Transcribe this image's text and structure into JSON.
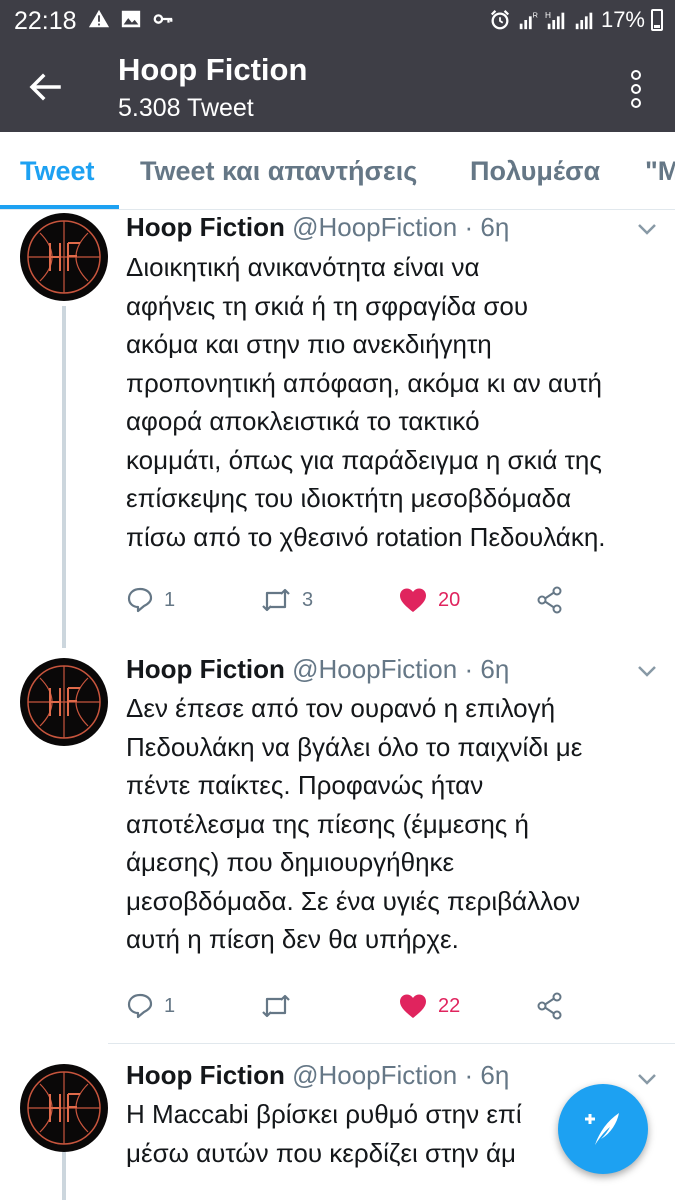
{
  "status_bar": {
    "time": "22:18",
    "battery": "17%",
    "left_icons": [
      "warning-icon",
      "image-icon",
      "key-icon"
    ],
    "right_icons": [
      "alarm-icon",
      "signal-r-icon",
      "signal-h-icon",
      "signal-icon"
    ]
  },
  "header": {
    "title": "Hoop Fiction",
    "subtitle": "5.308 Tweet"
  },
  "tabs": [
    {
      "label": "Tweet",
      "active": true
    },
    {
      "label": "Tweet και απαντήσεις",
      "active": false
    },
    {
      "label": "Πολυμέσα",
      "active": false
    },
    {
      "label": "\"Μ",
      "active": false
    }
  ],
  "tweets": [
    {
      "name": "Hoop Fiction",
      "handle": "@HoopFiction",
      "dot": "·",
      "time": "6η",
      "lines": [
        "Διοικητική ανικανότητα είναι να",
        "αφήνεις τη σκιά ή τη σφραγίδα σου",
        "ακόμα και στην πιο ανεκδιήγητη",
        "προπονητική απόφαση, ακόμα κι αν αυτή",
        "αφορά αποκλειστικά το τακτικό",
        "κομμάτι, όπως για παράδειγμα η σκιά της",
        "επίσκεψης του ιδιοκτήτη μεσοβδόμαδα",
        "πίσω από το χθεσινό rotation Πεδουλάκη."
      ],
      "replies": "1",
      "retweets": "3",
      "likes": "20"
    },
    {
      "name": "Hoop Fiction",
      "handle": "@HoopFiction",
      "dot": "·",
      "time": "6η",
      "lines": [
        "Δεν έπεσε από τον ουρανό η επιλογή",
        "Πεδουλάκη να βγάλει όλο το παιχνίδι με",
        "πέντε παίκτες. Προφανώς ήταν",
        "αποτέλεσμα της πίεσης (έμμεσης ή",
        "άμεσης) που δημιουργήθηκε",
        "μεσοβδόμαδα. Σε ένα υγιές περιβάλλον",
        "αυτή η πίεση δεν θα υπήρχε."
      ],
      "replies": "1",
      "retweets": "",
      "likes": "22"
    },
    {
      "name": "Hoop Fiction",
      "handle": "@HoopFiction",
      "dot": "·",
      "time": "6η",
      "lines": [
        "Η Maccabi βρίσκει ρυθμό στην επί",
        "μέσω αυτών που κερδίζει στην άμ"
      ]
    }
  ],
  "colors": {
    "header_bg": "#3e3e46",
    "accent": "#1da1f2",
    "like": "#e0245e",
    "secondary_text": "#657786"
  }
}
